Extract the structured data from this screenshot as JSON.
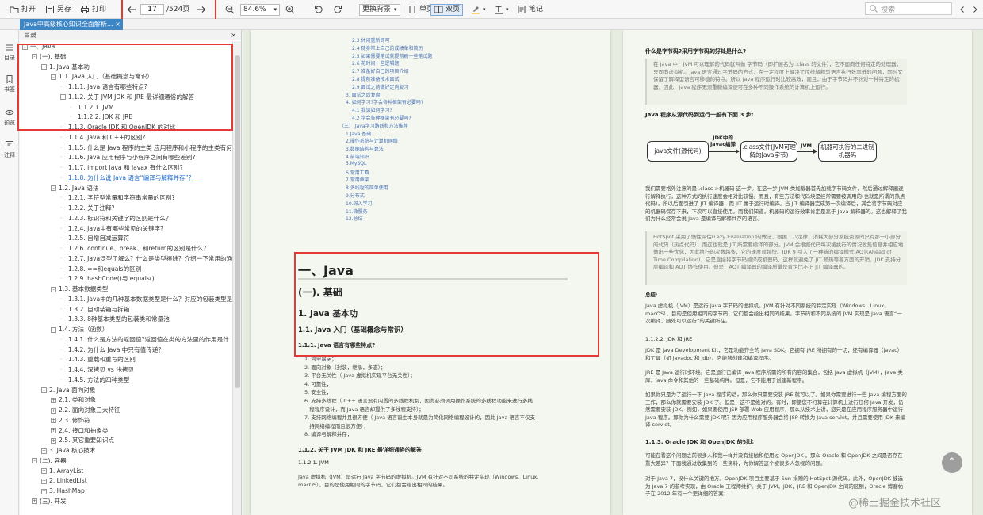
{
  "toolbar": {
    "open": "打开",
    "save_as": "另存",
    "print": "打印",
    "page_current": "17",
    "page_total": "/524页",
    "zoom": "84.6%",
    "background": "更换背景",
    "single_page": "单页",
    "double_page": "双页",
    "notes": "笔记",
    "search_placeholder": "搜索"
  },
  "tab": {
    "title": "Java中高级核心知识全面解析...",
    "close": "×"
  },
  "sidebar": {
    "toc": "目录",
    "bookmark": "书签",
    "preview": "预览",
    "annotate": "注释"
  },
  "toc": {
    "header": "目录",
    "items": [
      {
        "text": "一、Java",
        "level": 0,
        "tog": "-"
      },
      {
        "text": "(一). 基础",
        "level": 1,
        "tog": "-"
      },
      {
        "text": "1. Java 基本功",
        "level": 2,
        "tog": "-"
      },
      {
        "text": "1.1. Java 入门（基础概念与常识）",
        "level": 3,
        "tog": "-"
      },
      {
        "text": "1.1.1. Java 语言有哪些特点?",
        "level": 4,
        "tog": ""
      },
      {
        "text": "1.1.2. 关于 JVM JDK 和 JRE 最详细通俗的解答",
        "level": 4,
        "tog": "-"
      },
      {
        "text": "1.1.2.1. JVM",
        "level": 5,
        "tog": ""
      },
      {
        "text": "1.1.2.2. JDK 和 JRE",
        "level": 5,
        "tog": ""
      },
      {
        "text": "1.1.3. Oracle JDK 和 OpenJDK 的对比",
        "level": 4,
        "tog": ""
      },
      {
        "text": "1.1.4. Java 和 C++的区别?",
        "level": 4,
        "tog": ""
      },
      {
        "text": "1.1.5. 什么是 Java 程序的主类 应用程序和小程序的主类有何",
        "level": 4,
        "tog": ""
      },
      {
        "text": "1.1.6. Java 应用程序与小程序之间有哪些差别?",
        "level": 4,
        "tog": ""
      },
      {
        "text": "1.1.7. import java 和 javax 有什么区别？",
        "level": 4,
        "tog": ""
      },
      {
        "text": "1.1.8. 为什么说 Java 语言“编译与解释并存”？",
        "level": 4,
        "tog": "",
        "link": true
      },
      {
        "text": "1.2. Java 语法",
        "level": 3,
        "tog": "-"
      },
      {
        "text": "1.2.1. 字符型常量和字符串常量的区别?",
        "level": 4,
        "tog": ""
      },
      {
        "text": "1.2.2. 关于注释？",
        "level": 4,
        "tog": ""
      },
      {
        "text": "1.2.3. 标识符和关键字的区别是什么？",
        "level": 4,
        "tog": ""
      },
      {
        "text": "1.2.4. Java中有哪些常见的关键字？",
        "level": 4,
        "tog": ""
      },
      {
        "text": "1.2.5. 自增自减运算符",
        "level": 4,
        "tog": ""
      },
      {
        "text": "1.2.6. continue、break、和return的区别是什么？",
        "level": 4,
        "tog": ""
      },
      {
        "text": "1.2.7. Java泛型了解么？什么是类型擦除？介绍一下常用的通",
        "level": 4,
        "tog": ""
      },
      {
        "text": "1.2.8. ==和equals的区别",
        "level": 4,
        "tog": ""
      },
      {
        "text": "1.2.9. hashCode()与 equals()",
        "level": 4,
        "tog": ""
      },
      {
        "text": "1.3. 基本数据类型",
        "level": 3,
        "tog": "-"
      },
      {
        "text": "1.3.1. Java中的几种基本数据类型是什么？对应的包装类型是",
        "level": 4,
        "tog": ""
      },
      {
        "text": "1.3.2. 自动装箱与拆箱",
        "level": 4,
        "tog": ""
      },
      {
        "text": "1.3.3. 8种基本类型的包装类和常量池",
        "level": 4,
        "tog": ""
      },
      {
        "text": "1.4. 方法（函数）",
        "level": 3,
        "tog": "-"
      },
      {
        "text": "1.4.1. 什么是方法的返回值?返回值在类的方法里的作用是什",
        "level": 4,
        "tog": ""
      },
      {
        "text": "1.4.2. 为什么 Java 中只有值传递？",
        "level": 4,
        "tog": ""
      },
      {
        "text": "1.4.3. 重载和重写的区别",
        "level": 4,
        "tog": ""
      },
      {
        "text": "1.4.4. 深拷贝 vs 浅拷贝",
        "level": 4,
        "tog": ""
      },
      {
        "text": "1.4.5. 方法的四种类型",
        "level": 4,
        "tog": ""
      },
      {
        "text": "2. Java 面向对象",
        "level": 2,
        "tog": "-"
      },
      {
        "text": "2.1. 类和对象",
        "level": 3,
        "tog": "+"
      },
      {
        "text": "2.2. 面向对象三大特征",
        "level": 3,
        "tog": "+"
      },
      {
        "text": "2.3. 修饰符",
        "level": 3,
        "tog": "+"
      },
      {
        "text": "2.4. 接口和抽象类",
        "level": 3,
        "tog": "+"
      },
      {
        "text": "2.5. 其它重要知识点",
        "level": 3,
        "tog": "+"
      },
      {
        "text": "3. Java 核心技术",
        "level": 2,
        "tog": "+"
      },
      {
        "text": "(二). 容器",
        "level": 1,
        "tog": "-"
      },
      {
        "text": "1. ArrayList",
        "level": 2,
        "tog": "+"
      },
      {
        "text": "2. LinkedList",
        "level": 2,
        "tog": "+"
      },
      {
        "text": "3. HashMap",
        "level": 2,
        "tog": "+"
      },
      {
        "text": "(三). 开发",
        "level": 1,
        "tog": "+"
      }
    ]
  },
  "left_page": {
    "mini_toc": [
      {
        "text": "2.3 休闲重新即可",
        "indent": 2
      },
      {
        "text": "2.4 随身带上自己的成绩单和简历",
        "indent": 2
      },
      {
        "text": "2.5 如果需要笔试就提前刷一些笔试题",
        "indent": 2
      },
      {
        "text": "2.6 花时间一些逻辑题",
        "indent": 2
      },
      {
        "text": "2.7 准备好自己的项目介绍",
        "indent": 2
      },
      {
        "text": "2.8 提前准备技术面试",
        "indent": 2
      },
      {
        "text": "2.9 面试之前做好定向复习",
        "indent": 2
      },
      {
        "text": "3. 面试之后复盘",
        "indent": 1
      },
      {
        "text": "4. 如何学习?学会各种框架有必要吗?",
        "indent": 1
      },
      {
        "text": "4.1 我该如何学习?",
        "indent": 2
      },
      {
        "text": "4.2 学会各种框架有必要吗?",
        "indent": 2
      },
      {
        "text": "（三）.Java学习路线和方法推荐",
        "indent": 0
      },
      {
        "text": "1.Java 基础",
        "indent": 1
      },
      {
        "text": "2.操作系统与计算机网络",
        "indent": 1
      },
      {
        "text": "3.数据结构与算法",
        "indent": 1
      },
      {
        "text": "4.前端知识",
        "indent": 1
      },
      {
        "text": "5.MySQL",
        "indent": 1
      },
      {
        "text": "6.常用工具",
        "indent": 1
      },
      {
        "text": "7.常用框架",
        "indent": 1
      },
      {
        "text": "8.多线程的简单使用",
        "indent": 1
      },
      {
        "text": "9.分布式",
        "indent": 1
      },
      {
        "text": "10.深入学习",
        "indent": 1
      },
      {
        "text": "11.微服务",
        "indent": 1
      },
      {
        "text": "12.总结",
        "indent": 1
      }
    ],
    "h1": "一、Java",
    "h2": "(一). 基础",
    "h3": "1. Java 基本功",
    "h4": "1.1. Java 入门（基础概念与常识）",
    "h5": "1.1.1. Java 语言有哪些特点?",
    "features": [
      "1. 简单易学；",
      "2. 面向对象（封装，继承，多态）；",
      "3. 平台无关性（ Java 虚拟机实现平台无关性）；",
      "4. 可靠性；",
      "5. 安全性；",
      "6. 支持多线程（ C++ 语言没有内置的多线程机制，因此必须调用操作系统的多线程功能来进行多线",
      "   程程序设计，而 Java 语言却提供了多线程支持）；",
      "7. 支持网络编程并且很方便（ Java 语言诞生本身就是为简化网络编程设计的，因此 Java 语言不仅支",
      "   持网络编程而且很方便）；",
      "8. 编译与解释并存；"
    ],
    "h_112": "1.1.2. 关于 JVM JDK 和 JRE 最详细通俗的解答",
    "h_1121": "1.1.2.1. JVM",
    "jvm_para": "Java 虚拟机（JVM）是运行 Java 字节码的虚拟机。JVM 有针对不同系统的特定实现（Windows、Linux、macOS），目的是使用相同的字节码，它们都会给出相同的结果。"
  },
  "right_page": {
    "h_bytecode": "什么是字节码?采用字节码的好处是什么?",
    "bytecode_para": "在 Java 中，JVM 可以理解的代码就叫做 字节码（即扩展名为 .class 的文件），它不面向任何特定的处理器，只面向虚拟机。Java 语言通过字节码的方式，在一定程度上解决了传统解释型语言执行效率低的问题，同时又保留了解释型语言可移植的特点。所以 Java 程序运行时比较高效，而且，由于字节码并不针对一种特定的机器，因此，Java 程序无须重新编译便可在多种不同操作系统的计算机上运行。",
    "h_steps": "Java 程序从源代码到运行一般有下面 3 步:",
    "flow": {
      "box1": "java文件(源代码)",
      "arrow1": "JDK中的javac编译",
      "box2": ".class文件(JVM可理解的Java字节)",
      "arrow2": "JVM",
      "box3": "机器可执行的二进制机器码"
    },
    "para2": "我们需要格外注意的是 .class->机器码 这一步。在这一步 JVM 类加载器首先加载字节码文件，然后通过解释器逐行解释执行，这种方式的执行速度会相对比较慢。而且，有些方法和代码块是经常需要被调用的(也就是所谓的热点代码)，所以后面引进了 JIT 编译器，而 JIT 属于运行时编译。当 JIT 编译器完成第一次编译后，其会将字节码对应的机器码保存下来，下次可以直接使用。而我们知道，机器码的运行效率肯定是高于 Java 解释器的。这也解释了我们为什么经常会说 Java 是编译与解释共存的语言。",
    "quote": "HotSpot 采用了惰性评估(Lazy Evaluation)的做法，根据二八定律，消耗大部分系统资源的只有那一小部分的代码（热点代码），而这也就是 JIT 所需要编译的部分。JVM 会根据代码每次被执行的情况收集信息并相应地做出一些优化，因此执行的次数越多，它的速度就越快。JDK 9 引入了一种新的编译模式 AOT(Ahead of Time Compilation)，它是直接将字节码编译成机器码，这样就避免了 JIT 预热等各方面的开销。JDK 支持分层编译和 AOT 协作使用。但是，AOT 编译器的编译质量是肯定比不上 JIT 编译器的。",
    "summary_label": "总结:",
    "summary": "Java 虚拟机（JVM）是运行 Java 字节码的虚拟机。JVM 有针对不同系统的特定实现（Windows，Linux，macOS），目的是使用相同的字节码，它们都会给出相同的结果。字节码和不同系统的 JVM 实现是 Java 语言“一次编译，随处可以运行”的关键所在。",
    "h_1122": "1.1.2.2. JDK 和 JRE",
    "jdk_para": "JDK 是 Java Development Kit，它是功能齐全的 Java SDK。它拥有 JRE 所拥有的一切，还有编译器（javac）和工具（如 javadoc 和 jdb）。它能够创建和编译程序。",
    "jre_para": "JRE 是 Java 运行时环境。它是运行已编译 Java 程序所需的所有内容的集合，包括 Java 虚拟机（JVM），Java 类库，java 命令和其他的一些基础构件。但是，它不能用于创建新程序。",
    "install_para": "如果你只是为了运行一下 Java 程序的话，那么你只需要安装 JRE 就可以了。如果你需要进行一些 Java 编程方面的工作，那么你就需要安装 JDK 了。但是，这不是绝对的。有时，即使您不打算在计算机上进行任何 Java 开发，仍然需要安装 JDK。例如，如果要使用 JSP 部署 Web 应用程序，那么从技术上讲，您只是在应用程序服务器中运行 Java 程序。那你为什么需要 JDK 呢？因为应用程序服务器会将 JSP 转换为 Java servlet，并且需要使用 JDK 来编译 servlet。",
    "h_113": "1.1.3. Oracle JDK 和 OpenJDK 的对比",
    "oracle_para1": "可能在看这个问题之前很多人和我一样并没有接触和使用过 OpenJDK 。那么 Oracle 和 OpenJDK 之间是否存在重大差异？下面我通过收集到的一些资料，为你解答这个被很多人忽视的问题。",
    "oracle_para2": "对于 Java 7，没什么关键的地方。OpenJDK 项目主要基于 Sun 捐赠的 HotSpot 源代码。此外，OpenJDK 被选为 Java 7 的参考实现，由 Oracle 工程师维护。关于 JVM，JDK，JRE 和 OpenJDK 之间的区别，Oracle 博客帖子在 2012 年有一个更详细的答案："
  },
  "watermark": "@稀土掘金技术社区",
  "colors": {
    "accent": "#3d86c6",
    "highlight": "#e53935",
    "page_bg": "#f4f7ef",
    "doc_bg": "#e6ecdf"
  }
}
